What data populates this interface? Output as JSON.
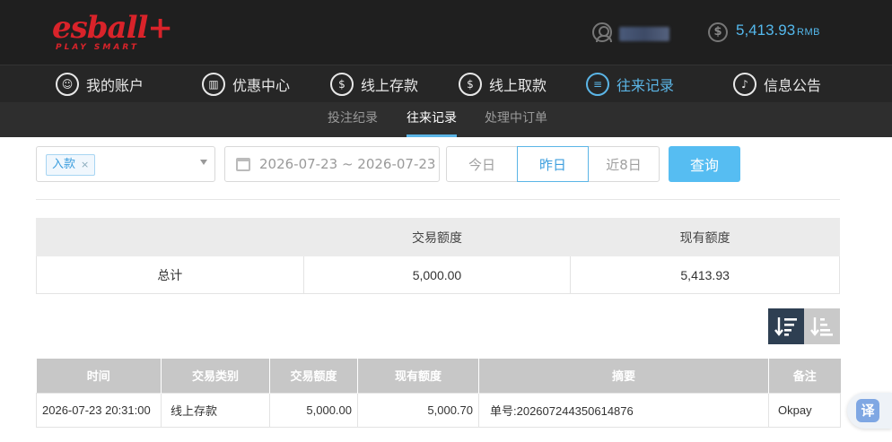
{
  "header": {
    "logo_text": "esball+",
    "logo_tagline": "PLAY SMART",
    "balance": "5,413.93",
    "currency": "RMB",
    "coin_symbol": "$"
  },
  "main_nav": [
    {
      "label": "我的账户",
      "icon": "user-circle-icon",
      "glyph": "☺"
    },
    {
      "label": "优惠中心",
      "icon": "gift-icon",
      "glyph": "▥"
    },
    {
      "label": "线上存款",
      "icon": "deposit-icon",
      "glyph": "$"
    },
    {
      "label": "线上取款",
      "icon": "withdraw-icon",
      "glyph": "$"
    },
    {
      "label": "往来记录",
      "icon": "records-icon",
      "glyph": "≡",
      "active": true
    },
    {
      "label": "信息公告",
      "icon": "bell-icon",
      "glyph": "♪"
    }
  ],
  "sub_nav": [
    {
      "label": "投注纪录"
    },
    {
      "label": "往来记录",
      "active": true
    },
    {
      "label": "处理中订单"
    }
  ],
  "filter": {
    "type_tag": "入款",
    "tag_close": "×",
    "date_range": "2026-07-23 ~ 2026-07-23",
    "quick_ranges": [
      "今日",
      "昨日",
      "近8日"
    ],
    "selected_range": "昨日",
    "query_label": "查询"
  },
  "summary": {
    "headers": [
      "",
      "交易额度",
      "现有额度"
    ],
    "row": [
      "总计",
      "5,000.00",
      "5,413.93"
    ]
  },
  "detail": {
    "headers": [
      "时间",
      "交易类别",
      "交易额度",
      "现有额度",
      "摘要",
      "备注"
    ],
    "rows": [
      [
        "2026-07-23 20:31:00",
        "线上存款",
        "5,000.00",
        "5,000.70",
        "单号:202607244350614876",
        "Okpay"
      ]
    ]
  },
  "translate": {
    "label": "译"
  },
  "colors": {
    "accent": "#5bb5e6",
    "brand_red": "#d9232a",
    "button": "#56bdf2",
    "header_bg": "#1f1f1f"
  }
}
